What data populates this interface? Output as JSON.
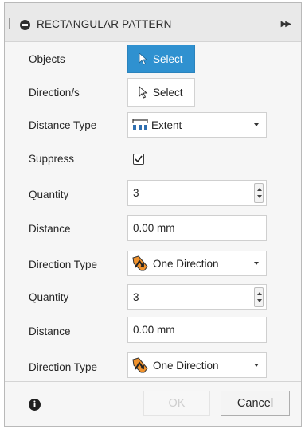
{
  "panel": {
    "title": "RECTANGULAR PATTERN",
    "expand_icon": "double-chevron-right-icon"
  },
  "rows": {
    "objects": {
      "label": "Objects",
      "button": "Select",
      "state": "active"
    },
    "directions": {
      "label": "Direction/s",
      "button": "Select",
      "state": "inactive"
    },
    "distance_type": {
      "label": "Distance Type",
      "value": "Extent",
      "icon": "extent-icon"
    },
    "suppress": {
      "label": "Suppress",
      "checked": true
    },
    "quantity_1": {
      "label": "Quantity",
      "value": "3"
    },
    "distance_1": {
      "label": "Distance",
      "value": "0.00 mm"
    },
    "direction_type_1": {
      "label": "Direction Type",
      "value": "One Direction",
      "icon": "one-direction-icon"
    },
    "quantity_2": {
      "label": "Quantity",
      "value": "3"
    },
    "distance_2": {
      "label": "Distance",
      "value": "0.00 mm"
    },
    "direction_type_2": {
      "label": "Direction Type",
      "value": "One Direction",
      "icon": "one-direction-icon"
    }
  },
  "footer": {
    "ok_label": "OK",
    "ok_enabled": false,
    "cancel_label": "Cancel",
    "info_icon": "info-icon"
  },
  "colors": {
    "accent": "#2f91d0",
    "direction_icon_orange": "#f0922d"
  }
}
